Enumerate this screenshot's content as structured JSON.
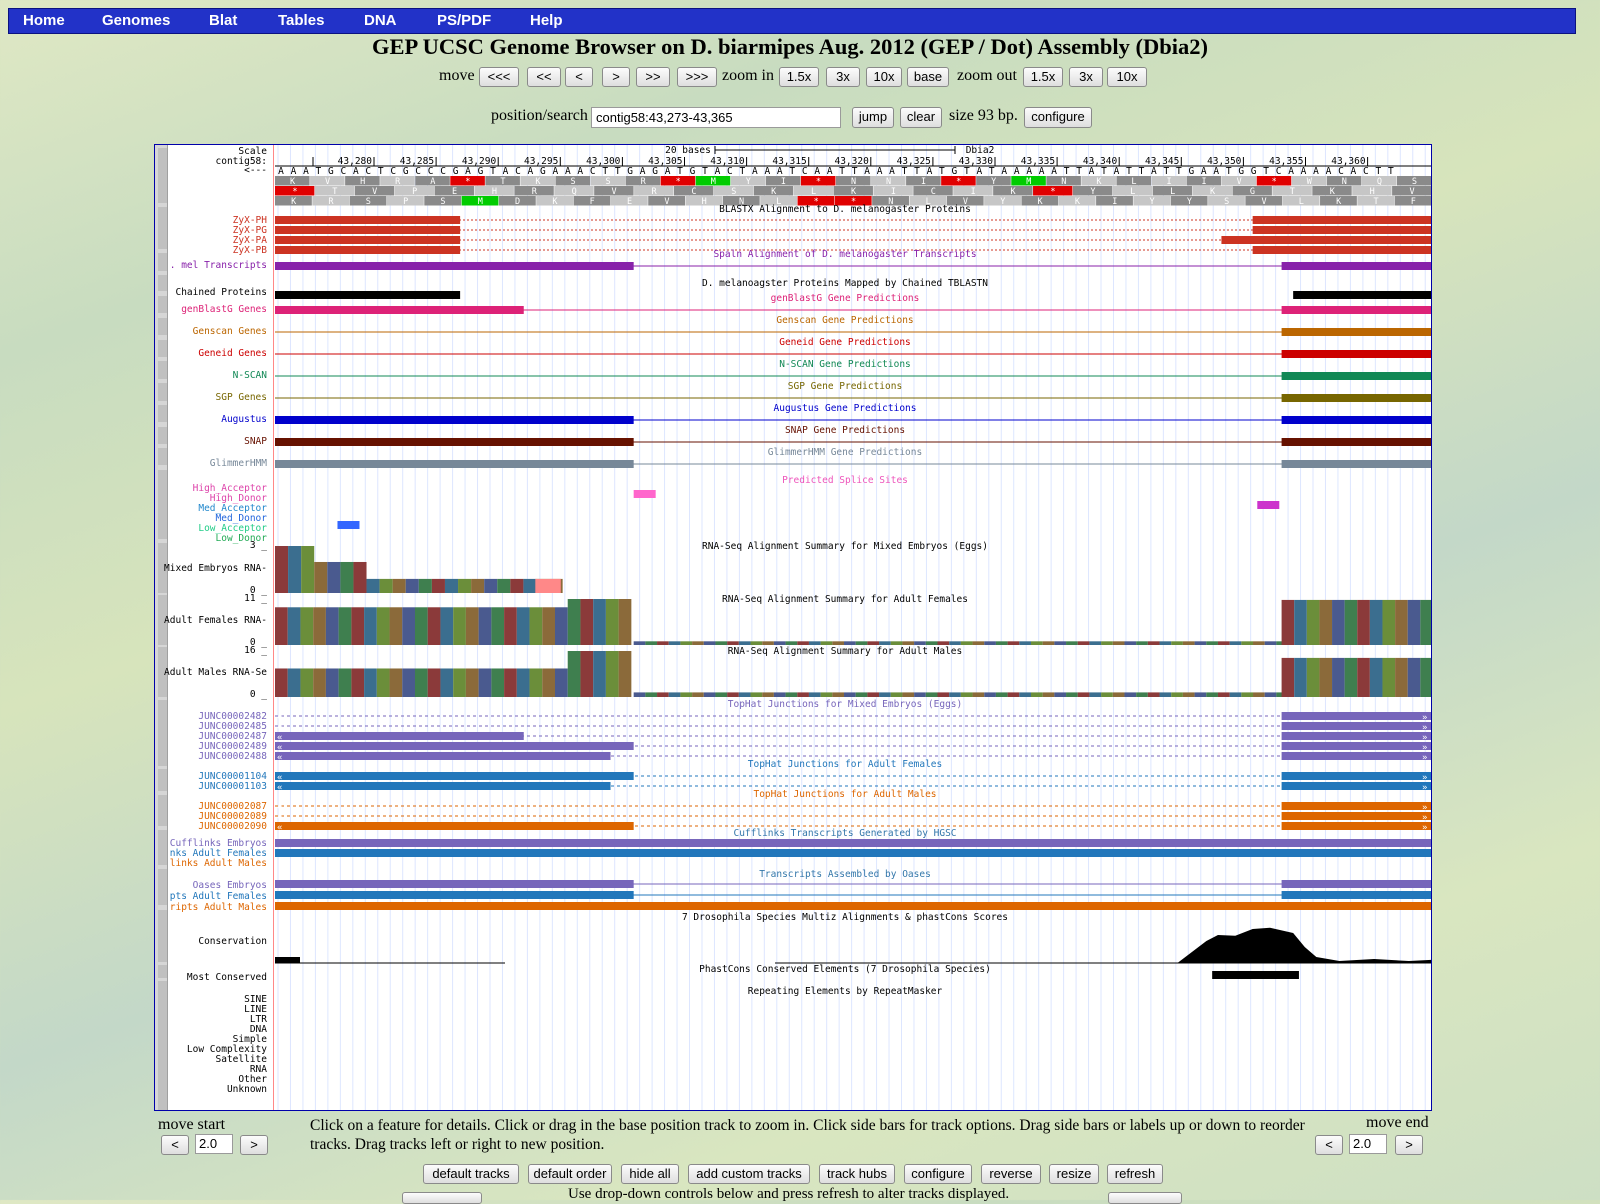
{
  "nav": {
    "home": "Home",
    "genomes": "Genomes",
    "blat": "Blat",
    "tables": "Tables",
    "dna": "DNA",
    "pspdf": "PS/PDF",
    "help": "Help"
  },
  "title": "GEP UCSC Genome Browser on D. biarmipes Aug. 2012 (GEP / Dot) Assembly (Dbia2)",
  "controls": {
    "move_label": "move",
    "move_buttons": [
      "<<<",
      "<<",
      "<",
      ">",
      ">>",
      ">>>"
    ],
    "zoom_in_label": "zoom in",
    "zoom_in_buttons": [
      "1.5x",
      "3x",
      "10x",
      "base"
    ],
    "zoom_out_label": "zoom out",
    "zoom_out_buttons": [
      "1.5x",
      "3x",
      "10x"
    ],
    "position_label": "position/search",
    "position_value": "contig58:43,273-43,365",
    "jump": "jump",
    "clear": "clear",
    "size_text": "size 93 bp.",
    "configure": "configure"
  },
  "colors": {
    "nav": "#2232c8",
    "red_feature": "#cc3322",
    "purple": "#8822aa",
    "magenta": "#dd2277",
    "genscan": "#bb6600",
    "geneid": "#cc0000",
    "nscan": "#118855",
    "sgp": "#776600",
    "augustus": "#0000cc",
    "snap": "#661100",
    "glimmer": "#778899",
    "junc_mixed": "#7766bb",
    "junc_females": "#2277bb",
    "junc_males": "#dd6600"
  },
  "browser": {
    "scale": {
      "label": "Scale",
      "scalebar_text": "20 bases",
      "assembly": "Dbia2",
      "contig": "contig58:",
      "strand": "<---",
      "ticks": [
        "43,280",
        "43,285",
        "43,290",
        "43,295",
        "43,300",
        "43,305",
        "43,310",
        "43,315",
        "43,320",
        "43,325",
        "43,330",
        "43,335",
        "43,340",
        "43,345",
        "43,350",
        "43,355",
        "43,360"
      ],
      "sequence": "AAATGCACTCGCCCGAGTACAGAAACTTGAGATGTACTAAATCAATTAAATTATGTATAAAAATTATATTATTGAATGGTCAAAACACTT",
      "frames": [
        [
          "K",
          "V",
          "H",
          "R",
          "A",
          "*",
          "T",
          "K",
          "S",
          "S",
          "R",
          "*",
          "M",
          "Y",
          "I",
          "*",
          "N",
          "N",
          "I",
          "*",
          "Y",
          "M",
          "N",
          "K",
          "L",
          "I",
          "I",
          "V",
          "*",
          "W",
          "N",
          "Q",
          "S"
        ],
        [
          "*",
          "T",
          "V",
          "P",
          "E",
          "H",
          "R",
          "Q",
          "V",
          "R",
          "C",
          "S",
          "K",
          "L",
          "K",
          "I",
          "C",
          "I",
          "K",
          "*",
          "Y",
          "L",
          "L",
          "K",
          "G",
          "T",
          "K",
          "H",
          "V"
        ],
        [
          "K",
          "R",
          "S",
          "P",
          "S",
          "M",
          "D",
          "K",
          "F",
          "E",
          "V",
          "H",
          "N",
          "L",
          "*",
          "*",
          "N",
          "L",
          "V",
          "Y",
          "K",
          "K",
          "I",
          "Y",
          "Y",
          "S",
          "V",
          "L",
          "K",
          "T",
          "F"
        ]
      ]
    },
    "tracks": {
      "blastx": {
        "title": "BLASTX Alignment to D. melanogaster Proteins",
        "items": [
          "ZyX-PH",
          "ZyX-PG",
          "ZyX-PA",
          "ZyX-PB"
        ]
      },
      "spaln": {
        "title": "Spaln Alignment of D. melanogaster Transcripts",
        "label": ". mel Transcripts"
      },
      "chained": {
        "title": "D. melanoagster Proteins Mapped by Chained TBLASTN",
        "label": "Chained Proteins"
      },
      "genblastg": {
        "title": "genBlastG Gene Predictions",
        "label": "genBlastG Genes"
      },
      "genscan": {
        "title": "Genscan Gene Predictions",
        "label": "Genscan Genes"
      },
      "geneid": {
        "title": "Geneid Gene Predictions",
        "label": "Geneid Genes"
      },
      "nscan": {
        "title": "N-SCAN Gene Predictions",
        "label": "N-SCAN"
      },
      "sgp": {
        "title": "SGP Gene Predictions",
        "label": "SGP Genes"
      },
      "augustus": {
        "title": "Augustus Gene Predictions",
        "label": "Augustus"
      },
      "snap": {
        "title": "SNAP Gene Predictions",
        "label": "SNAP"
      },
      "glimmer": {
        "title": "GlimmerHMM Gene Predictions",
        "label": "GlimmerHMM"
      },
      "splice": {
        "title": "Predicted Splice Sites",
        "labels": [
          "High_Acceptor",
          "High_Donor",
          "Med_Acceptor",
          "Med_Donor",
          "Low_Acceptor",
          "Low_Donor"
        ]
      },
      "rna_mixed": {
        "title": "RNA-Seq Alignment Summary for Mixed Embryos (Eggs)",
        "label": "Mixed Embryos RNA-",
        "max": "3 _",
        "min": "0 _"
      },
      "rna_females": {
        "title": "RNA-Seq Alignment Summary for Adult Females",
        "label": "Adult Females RNA-",
        "max": "11 _",
        "min": "0 _"
      },
      "rna_males": {
        "title": "RNA-Seq Alignment Summary for Adult Males",
        "label": "Adult Males RNA-Se",
        "max": "16 _",
        "min": "0 _"
      },
      "tophat_mixed": {
        "title": "TopHat Junctions for Mixed Embryos (Eggs)",
        "items": [
          "JUNC00002482",
          "JUNC00002485",
          "JUNC00002487",
          "JUNC00002489",
          "JUNC00002488"
        ]
      },
      "tophat_females": {
        "title": "TopHat Junctions for Adult Females",
        "items": [
          "JUNC00001104",
          "JUNC00001103"
        ]
      },
      "tophat_males": {
        "title": "TopHat Junctions for Adult Males",
        "items": [
          "JUNC00002087",
          "JUNC00002089",
          "JUNC00002090"
        ]
      },
      "cufflinks": {
        "title": "Cufflinks Transcripts Generated by HGSC",
        "items": [
          "Cufflinks Embryos",
          "nks Adult Females",
          "links Adult Males"
        ]
      },
      "oases": {
        "title": "Transcripts Assembled by Oases",
        "items": [
          "Oases Embryos",
          "pts Adult Females",
          "ripts Adult Males"
        ]
      },
      "multiz": {
        "title": "7 Drosophila Species Multiz Alignments & phastCons Scores",
        "label": "Conservation"
      },
      "phastcons": {
        "title": "PhastCons Conserved Elements (7 Drosophila Species)",
        "label": "Most Conserved"
      },
      "repeatmasker": {
        "title": "Repeating Elements by RepeatMasker",
        "items": [
          "SINE",
          "LINE",
          "LTR",
          "DNA",
          "Simple",
          "Low Complexity",
          "Satellite",
          "RNA",
          "Other",
          "Unknown"
        ]
      }
    }
  },
  "bottom": {
    "move_start": "move start",
    "move_end": "move end",
    "step_value": "2.0",
    "left": "<",
    "right": ">",
    "instructions": "Click on a feature for details. Click or drag in the base position track to zoom in. Click side bars for track options. Drag side bars or labels up or down to reorder tracks. Drag tracks left or right to new position.",
    "buttons": [
      "default tracks",
      "default order",
      "hide all",
      "add custom tracks",
      "track hubs",
      "configure",
      "reverse",
      "resize",
      "refresh"
    ],
    "dropdown_note": "Use drop-down controls below and press refresh to alter tracks displayed."
  }
}
